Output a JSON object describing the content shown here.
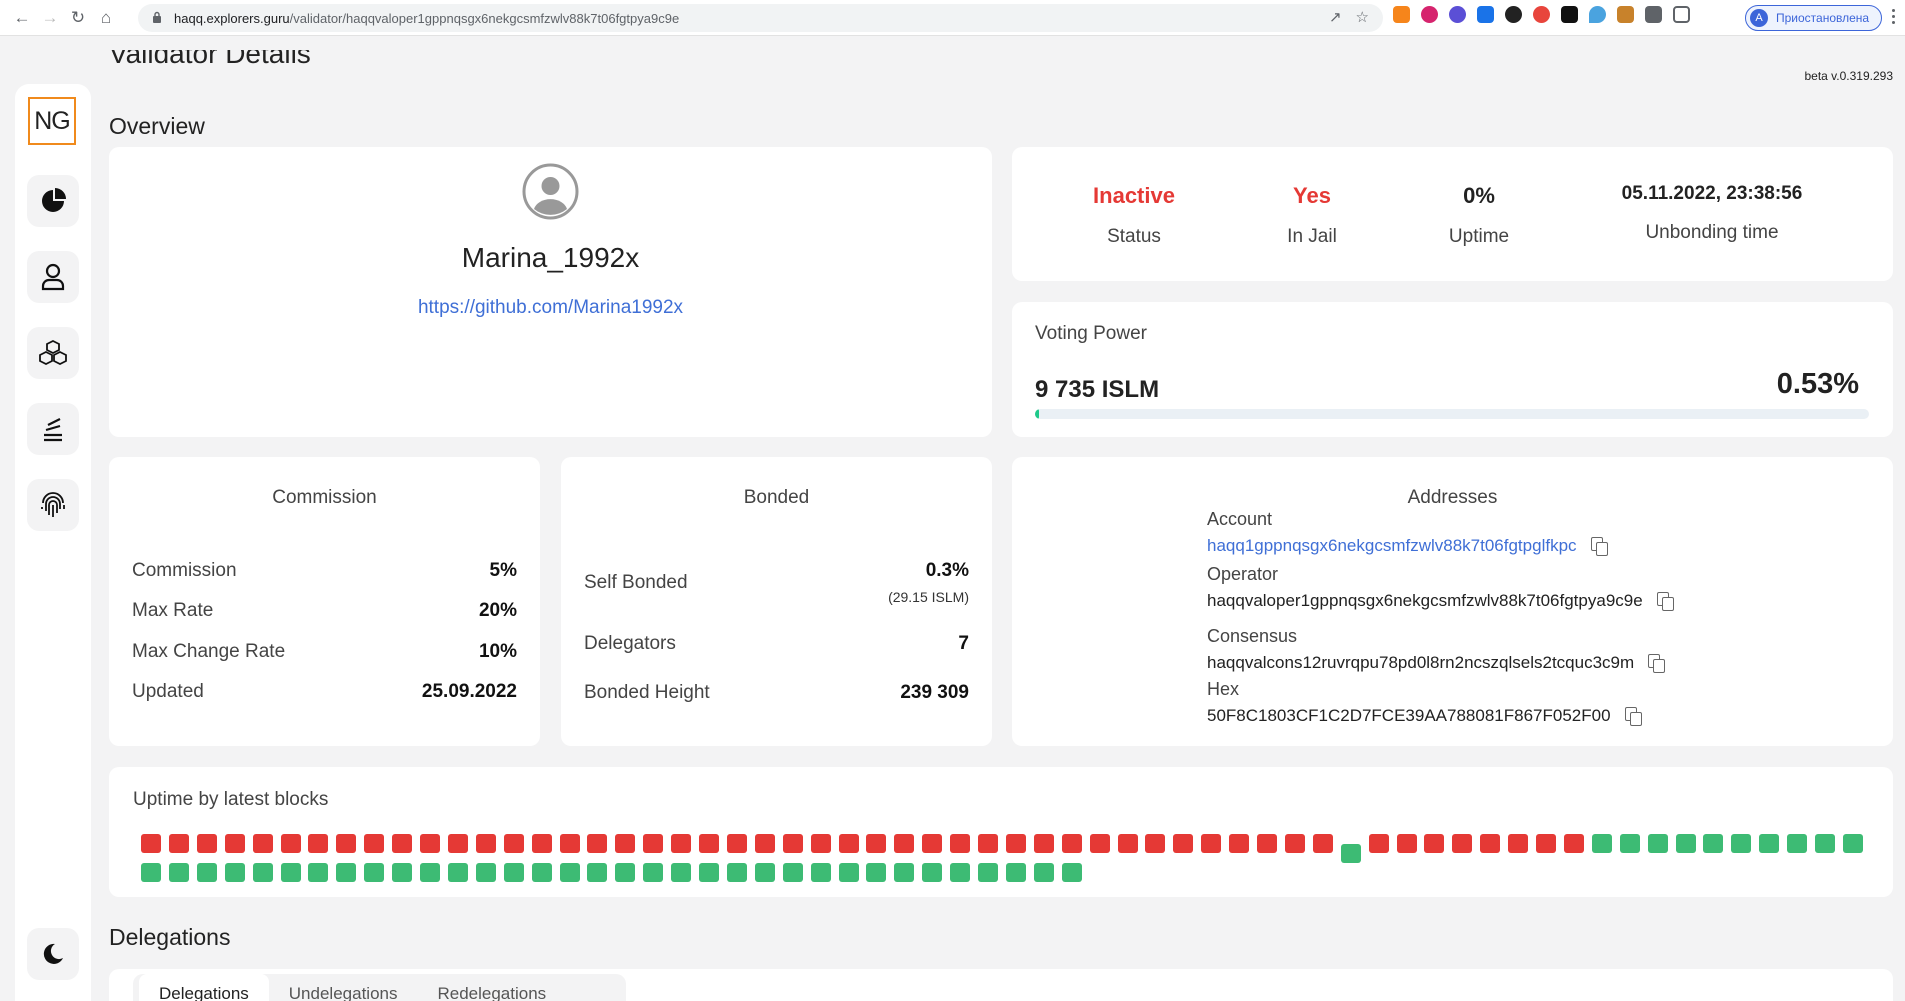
{
  "browser": {
    "url_host": "haqq.explorers.guru",
    "url_path": "/validator/haqqvaloper1gppnqsgx6nekgcsmfzwlv88k7t06fgtpya9c9e",
    "profile_initial": "A",
    "profile_label": "Приостановлена"
  },
  "app": {
    "logo": "NG",
    "page_title": "Validator Details",
    "version": "beta v.0.319.293",
    "nav_icons": [
      "pie-chart-icon",
      "user-icon",
      "cubes-icon",
      "stack-icon",
      "fingerprint-icon"
    ],
    "theme_icon": "moon-icon"
  },
  "overview": {
    "title": "Overview",
    "moniker": "Marina_1992x",
    "website": "https://github.com/Marina1992x"
  },
  "status": {
    "status_value": "Inactive",
    "status_label": "Status",
    "jail_value": "Yes",
    "jail_label": "In Jail",
    "uptime_value": "0%",
    "uptime_label": "Uptime",
    "unbonding_value": "05.11.2022, 23:38:56",
    "unbonding_label": "Unbonding time",
    "alert_color": "#e53935"
  },
  "voting_power": {
    "label": "Voting Power",
    "amount": "9 735 ISLM",
    "percent": "0.53%",
    "fraction": 0.0053,
    "bar_color": "#1ec98a"
  },
  "commission": {
    "title": "Commission",
    "rows": [
      {
        "label": "Commission",
        "value": "5%"
      },
      {
        "label": "Max Rate",
        "value": "20%"
      },
      {
        "label": "Max Change Rate",
        "value": "10%"
      },
      {
        "label": "Updated",
        "value": "25.09.2022"
      }
    ]
  },
  "bonded": {
    "title": "Bonded",
    "self_bonded_label": "Self Bonded",
    "self_bonded_value": "0.3%",
    "self_bonded_sub": "(29.15 ISLM)",
    "delegators_label": "Delegators",
    "delegators_value": "7",
    "height_label": "Bonded Height",
    "height_value": "239 309"
  },
  "addresses": {
    "title": "Addresses",
    "account_label": "Account",
    "account": "haqq1gppnqsgx6nekgcsmfzwlv88k7t06fgtpglfkpc",
    "operator_label": "Operator",
    "operator": "haqqvaloper1gppnqsgx6nekgcsmfzwlv88k7t06fgtpya9c9e",
    "consensus_label": "Consensus",
    "consensus": "haqqvalcons12ruvrqpu78pd0l8rn2ncszqlsels2tcquc3c9m",
    "hex_label": "Hex",
    "hex": "50F8C1803CF1C2D7FCE39AA788081F867F052F00"
  },
  "uptime": {
    "title": "Uptime by latest blocks",
    "missed_color": "#e53935",
    "signed_color": "#3dbb74",
    "row1": [
      "m",
      "m",
      "m",
      "m",
      "m",
      "m",
      "m",
      "m",
      "m",
      "m",
      "m",
      "m",
      "m",
      "m",
      "m",
      "m",
      "m",
      "m",
      "m",
      "m",
      "m",
      "m",
      "m",
      "m",
      "m",
      "m",
      "m",
      "m",
      "m",
      "m",
      "m",
      "m",
      "m",
      "m",
      "m",
      "m",
      "m",
      "m",
      "m",
      "m",
      "m",
      "m",
      "m",
      "s",
      "m",
      "m",
      "m",
      "m",
      "m",
      "m",
      "m",
      "m",
      "s",
      "s",
      "s",
      "s",
      "s",
      "s",
      "s",
      "s",
      "s",
      "s"
    ],
    "row2": [
      "s",
      "s",
      "s",
      "s",
      "s",
      "s",
      "s",
      "s",
      "s",
      "s",
      "s",
      "s",
      "s",
      "s",
      "s",
      "s",
      "s",
      "s",
      "s",
      "s",
      "s",
      "s",
      "s",
      "s",
      "s",
      "s",
      "s",
      "s",
      "s",
      "s",
      "s",
      "s",
      "s",
      "s"
    ]
  },
  "delegations": {
    "title": "Delegations",
    "tabs": [
      "Delegations",
      "Undelegations",
      "Redelegations"
    ]
  }
}
